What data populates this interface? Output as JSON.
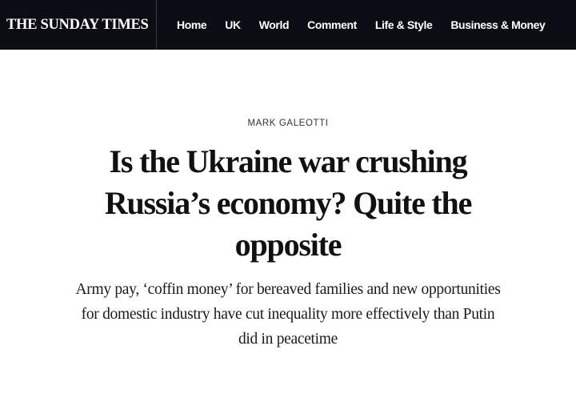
{
  "header": {
    "brand": "THE SUNDAY TIMES",
    "nav": [
      "Home",
      "UK",
      "World",
      "Comment",
      "Life & Style",
      "Business & Money"
    ]
  },
  "article": {
    "byline": "MARK GALEOTTI",
    "headline": "Is the Ukraine war crushing Russia’s economy? Quite the opposite",
    "standfirst": "Army pay, ‘coffin money’ for bereaved families and new opportunities for domestic industry have cut inequality more effectively than Putin did in peacetime"
  },
  "colors": {
    "masthead_bg": "#0c0c14",
    "page_bg": "#ffffff",
    "text": "#111111"
  }
}
